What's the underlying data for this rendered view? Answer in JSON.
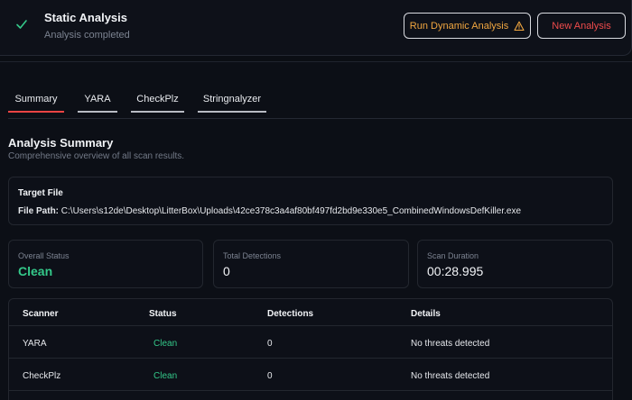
{
  "header": {
    "title": "Static Analysis",
    "subtitle": "Analysis completed",
    "dynamic_button": "Run Dynamic Analysis",
    "new_button": "New Analysis"
  },
  "tabs": [
    {
      "label": "Summary",
      "active": true
    },
    {
      "label": "YARA",
      "active": false
    },
    {
      "label": "CheckPlz",
      "active": false
    },
    {
      "label": "Stringnalyzer",
      "active": false
    }
  ],
  "section": {
    "title": "Analysis Summary",
    "subtitle": "Comprehensive overview of all scan results."
  },
  "target": {
    "label": "Target File",
    "path_label": "File Path:",
    "path": "C:\\Users\\s12de\\Desktop\\LitterBox\\Uploads\\42ce378c3a4af80bf497fd2bd9e330e5_CombinedWindowsDefKiller.exe"
  },
  "stats": {
    "overall_label": "Overall Status",
    "overall_value": "Clean",
    "detections_label": "Total Detections",
    "detections_value": "0",
    "duration_label": "Scan Duration",
    "duration_value": "00:28.995"
  },
  "table": {
    "headers": [
      "Scanner",
      "Status",
      "Detections",
      "Details"
    ],
    "rows": [
      {
        "scanner": "YARA",
        "status": "Clean",
        "detections": "0",
        "details": "No threats detected"
      },
      {
        "scanner": "CheckPlz",
        "status": "Clean",
        "detections": "0",
        "details": "No threats detected"
      }
    ]
  },
  "colors": {
    "success": "#34c98a",
    "danger": "#ef4444",
    "warning": "#f0a640",
    "background": "#0b0e14"
  },
  "icons": {
    "status": "check-icon",
    "dynamic": "warning-triangle-icon"
  }
}
